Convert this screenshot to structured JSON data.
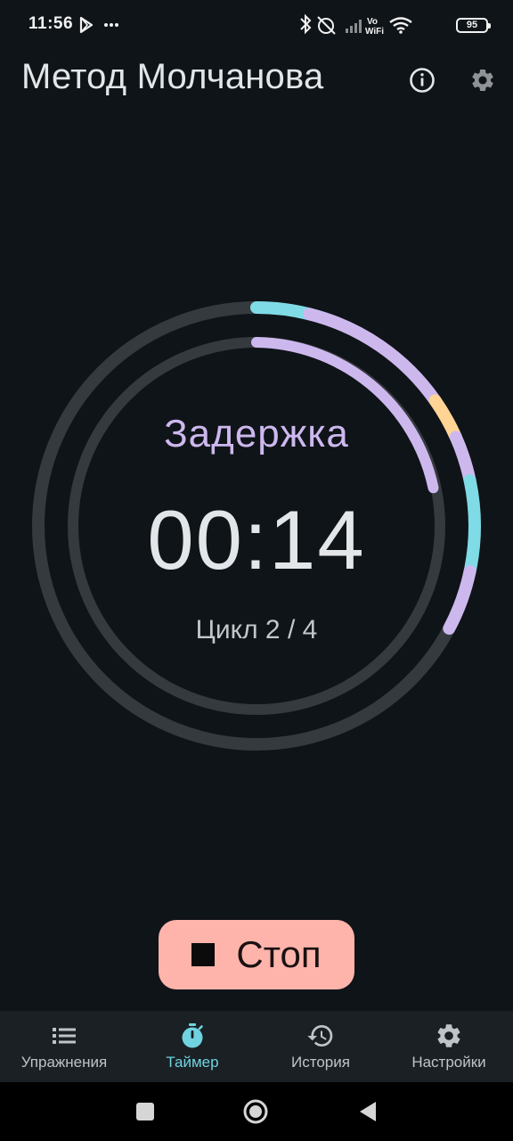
{
  "status_bar": {
    "time": "11:56",
    "battery": "95",
    "network_label_top": "Vo",
    "network_label_bottom": "WiFi"
  },
  "app_bar": {
    "title": "Метод Молчанова",
    "info_icon": "info-icon",
    "settings_icon": "gear-icon"
  },
  "timer": {
    "phase": "Задержка",
    "time": "00:14",
    "cycle": "Цикл 2 / 4",
    "colors": {
      "track": "#353a3e",
      "purple": "#cdb8ee",
      "cyan": "#7fdbe6",
      "orange": "#ffd495"
    }
  },
  "stop_button": {
    "label": "Стоп",
    "icon": "stop-icon",
    "color": "#ffb4ab"
  },
  "bottom_nav": {
    "items": [
      {
        "label": "Упражнения",
        "icon": "list-icon",
        "active": false
      },
      {
        "label": "Таймер",
        "icon": "stopwatch-icon",
        "active": true
      },
      {
        "label": "История",
        "icon": "history-icon",
        "active": false
      },
      {
        "label": "Настройки",
        "icon": "gear-icon",
        "active": false
      }
    ],
    "active_color": "#6fd3e0"
  },
  "system_nav": {
    "recents_icon": "square-icon",
    "home_icon": "circle-icon",
    "back_icon": "triangle-back-icon"
  }
}
